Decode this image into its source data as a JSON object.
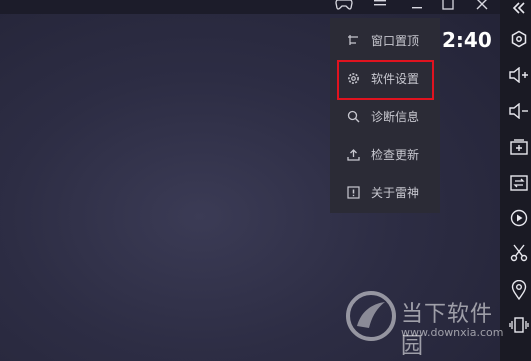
{
  "clock": "2:40",
  "window_controls": {
    "gamepad_icon": "gamepad-icon",
    "menu_icon": "hamburger-icon",
    "restore_icon": "restore-icon",
    "close_icon": "close-icon"
  },
  "menu": {
    "items": [
      {
        "label": "窗口置顶",
        "icon": "pin-icon"
      },
      {
        "label": "软件设置",
        "icon": "gear-icon"
      },
      {
        "label": "诊断信息",
        "icon": "search-icon"
      },
      {
        "label": "检查更新",
        "icon": "upload-icon"
      },
      {
        "label": "关于雷神",
        "icon": "info-icon"
      }
    ],
    "highlighted": "软件设置",
    "highlight_color": "#e0131f"
  },
  "sidebar": {
    "icons": [
      "collapse-icon",
      "hexagon-settings-icon",
      "volume-up-icon",
      "volume-down-icon",
      "add-window-icon",
      "switch-icon",
      "play-icon",
      "scissors-icon",
      "location-icon",
      "shake-icon"
    ]
  },
  "watermark": {
    "name": "当下软件园",
    "url": "www.downxia.com"
  },
  "colors": {
    "background": "#2d2d44",
    "menu_bg": "#2b2b36",
    "sidebar_bg": "#1a1a24"
  }
}
